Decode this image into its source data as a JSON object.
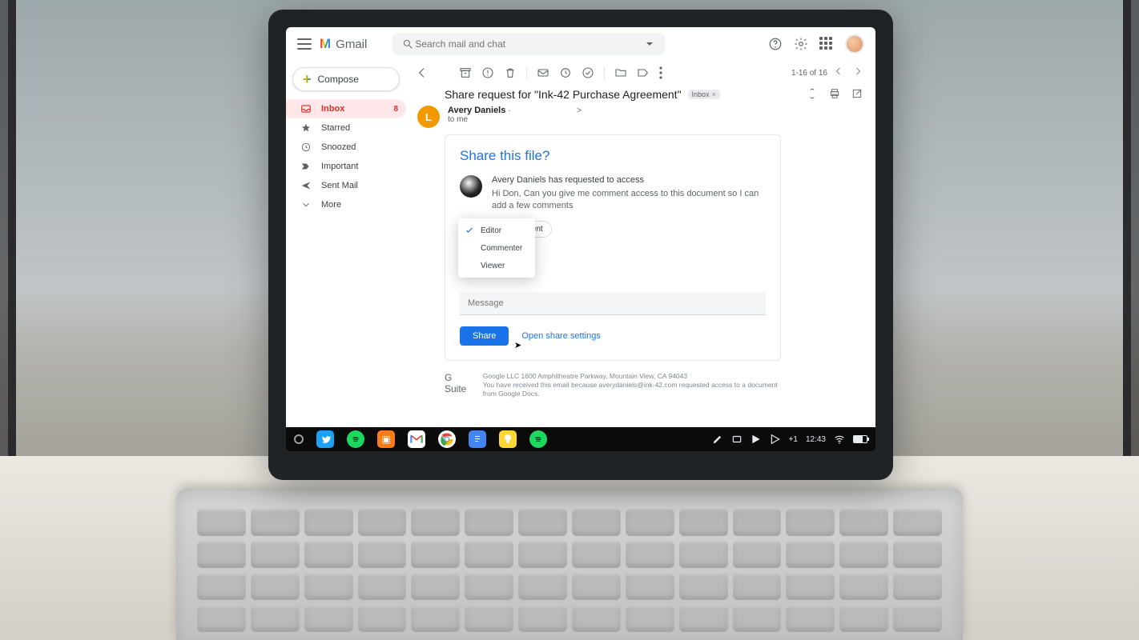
{
  "header": {
    "product": "Gmail",
    "search_placeholder": "Search mail and chat"
  },
  "compose_label": "Compose",
  "nav": [
    {
      "label": "Inbox",
      "badge": "8"
    },
    {
      "label": "Starred"
    },
    {
      "label": "Snoozed"
    },
    {
      "label": "Important"
    },
    {
      "label": "Sent Mail"
    },
    {
      "label": "More"
    }
  ],
  "toolbar": {
    "count": "1-16 of 16"
  },
  "subject": "Share request for \"Ink-42 Purchase Agreement\"",
  "subject_chip": "Inbox",
  "sender": {
    "initial": "L",
    "name": "Avery Daniels",
    "sep": "·",
    "angle": ">",
    "to": "to me"
  },
  "share": {
    "title": "Share this file?",
    "request_line": "Avery Daniels has requested to access",
    "request_msg": "Hi Don, Can you give me comment access to this document so I can add a few comments",
    "doc_name": "reement",
    "options": [
      "Editor",
      "Commenter",
      "Viewer"
    ],
    "message_placeholder": "Message",
    "share_btn": "Share",
    "open_settings": "Open share settings"
  },
  "footer": {
    "brand": "G Suite",
    "line1": "Google LLC 1600 Amphitheatre Parkway, Mountain View, CA 94043",
    "line2": "You have received this email because averydaniels@ink-42.com requested access to a document from Google Docs."
  },
  "shelf": {
    "plus": "+1",
    "time": "12:43"
  }
}
